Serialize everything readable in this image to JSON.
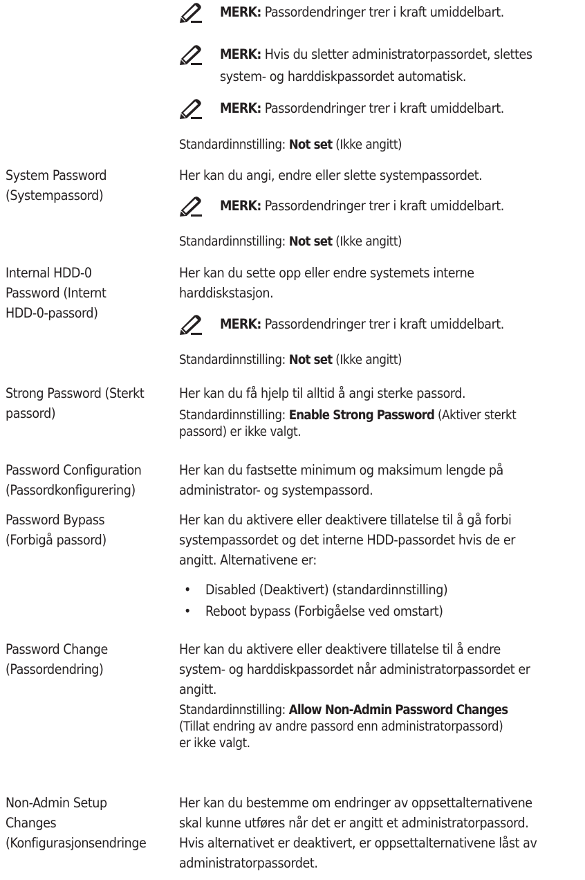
{
  "icons": {
    "note_icon": "pencil-note-icon"
  },
  "top_notes": [
    {
      "prefix": "MERK:",
      "text": " Passordendringer trer i kraft umiddelbart."
    },
    {
      "prefix": "MERK:",
      "text_line1": " Hvis du sletter administratorpassordet, slettes",
      "text_line2": "system- og harddiskpassordet automatisk."
    },
    {
      "prefix": "MERK:",
      "text": " Passordendringer trer i kraft umiddelbart."
    }
  ],
  "top_default": {
    "prefix": "Standardinnstilling: ",
    "value": "Not set",
    "suffix": " (Ikke angitt)"
  },
  "settings": [
    {
      "label_lines": [
        "System Password",
        "(Systempassord)"
      ],
      "desc_lines": [
        "Her kan du angi, endre eller slette systempassordet."
      ],
      "note": {
        "prefix": "MERK:",
        "text": " Passordendringer trer i kraft umiddelbart."
      },
      "default": {
        "prefix": "Standardinnstilling: ",
        "value": "Not set",
        "suffix": " (Ikke angitt)"
      }
    },
    {
      "label_lines": [
        "Internal HDD-0",
        "Password (Internt",
        "HDD-0-passord)"
      ],
      "desc_lines": [
        "Her kan du sette opp eller endre systemets interne",
        "harddiskstasjon."
      ],
      "note": {
        "prefix": "MERK:",
        "text": " Passordendringer trer i kraft umiddelbart."
      },
      "default": {
        "prefix": "Standardinnstilling: ",
        "value": "Not set",
        "suffix": " (Ikke angitt)"
      }
    },
    {
      "label_lines": [
        "Strong Password (Sterkt",
        "passord)"
      ],
      "desc_lines": [
        "Her kan du få hjelp til alltid å angi sterke passord."
      ],
      "default": {
        "prefix": "Standardinnstilling: ",
        "value": "Enable Strong Password",
        "suffix_line1": " (Aktiver sterkt",
        "suffix_line2": "passord) er ikke valgt."
      }
    },
    {
      "label_lines": [
        "Password Configuration",
        "(Passordkonfigurering)"
      ],
      "desc_lines": [
        "Her kan du fastsette minimum og maksimum lengde på",
        "administrator- og systempassord."
      ]
    },
    {
      "label_lines": [
        "Password Bypass",
        "(Forbigå passord)"
      ],
      "desc_lines": [
        "Her kan du aktivere eller deaktivere tillatelse til å gå forbi",
        "systempassordet og det interne HDD-passordet hvis de er",
        "angitt. Alternativene er:"
      ],
      "options": [
        "Disabled (Deaktivert) (standardinnstilling)",
        "Reboot bypass (Forbigåelse ved omstart)"
      ]
    },
    {
      "label_lines": [
        "Password Change",
        "(Passordendring)"
      ],
      "desc_lines": [
        "Her kan du aktivere eller deaktivere tillatelse til å endre",
        "system- og harddiskpassordet når administratorpassordet er",
        "angitt."
      ],
      "default": {
        "prefix": "Standardinnstilling: ",
        "value": "Allow Non-Admin Password Changes",
        "suffix_lines": [
          "(Tillat endring av andre passord enn administratorpassord)",
          "er ikke valgt."
        ]
      }
    },
    {
      "label_lines": [
        "Non-Admin Setup",
        "Changes",
        "(Konfigurasjonsendringe"
      ],
      "desc_lines": [
        "Her kan du bestemme om endringer av oppsettalternativene",
        "skal kunne utføres når det er angitt et administratorpassord.",
        "Hvis alternativet er deaktivert, er oppsettalternativene låst av",
        "administratorpassordet."
      ]
    }
  ]
}
